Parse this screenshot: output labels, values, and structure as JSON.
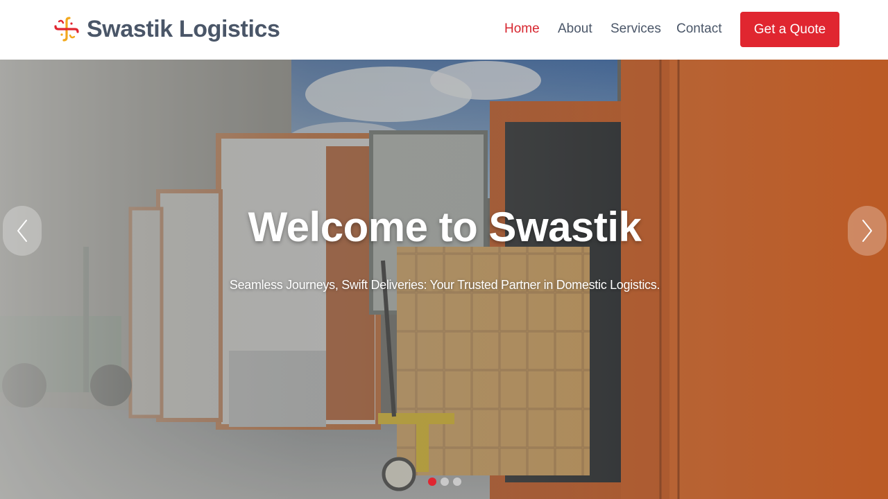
{
  "brand": {
    "name": "Swastik Logistics",
    "logo_icon": "swastik-logo-icon",
    "logo_colors": [
      "#e02630",
      "#f2a81d"
    ]
  },
  "nav": {
    "items": [
      {
        "label": "Home",
        "active": true
      },
      {
        "label": "About",
        "active": false
      },
      {
        "label": "Services",
        "active": false
      },
      {
        "label": "Contact",
        "active": false
      }
    ],
    "cta_label": "Get a Quote"
  },
  "hero": {
    "title": "Welcome to Swastik",
    "subtitle": "Seamless Journeys, Swift Deliveries: Your Trusted Partner in Domestic Logistics.",
    "background_scene": "warehouse-loading-dock-photo",
    "prev_icon": "chevron-left-icon",
    "next_icon": "chevron-right-icon",
    "slide_count": 3,
    "active_slide": 1
  },
  "colors": {
    "accent": "#e02630",
    "nav_text": "#4a5668",
    "active_nav": "#d7262f"
  }
}
